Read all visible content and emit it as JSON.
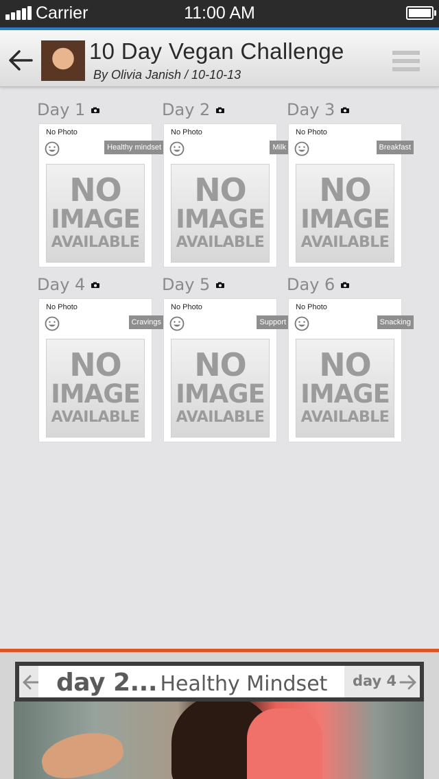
{
  "status_bar": {
    "carrier": "Carrier",
    "time": "11:00 AM"
  },
  "header": {
    "title": "10 Day Vegan Challenge",
    "subtitle": "By Olivia Janish / 10-10-13"
  },
  "days": [
    {
      "label": "Day 1",
      "photo_status": "No Photo",
      "tag": "Healthy mindset",
      "placeholder": [
        "NO",
        "IMAGE",
        "AVAILABLE"
      ]
    },
    {
      "label": "Day 2",
      "photo_status": "No Photo",
      "tag": "Milk",
      "placeholder": [
        "NO",
        "IMAGE",
        "AVAILABLE"
      ]
    },
    {
      "label": "Day 3",
      "photo_status": "No Photo",
      "tag": "Breakfast",
      "placeholder": [
        "NO",
        "IMAGE",
        "AVAILABLE"
      ]
    },
    {
      "label": "Day 4",
      "photo_status": "No Photo",
      "tag": "Cravings",
      "placeholder": [
        "NO",
        "IMAGE",
        "AVAILABLE"
      ]
    },
    {
      "label": "Day 5",
      "photo_status": "No Photo",
      "tag": "Support",
      "placeholder": [
        "NO",
        "IMAGE",
        "AVAILABLE"
      ]
    },
    {
      "label": "Day 6",
      "photo_status": "No Photo",
      "tag": "Snacking",
      "placeholder": [
        "NO",
        "IMAGE",
        "AVAILABLE"
      ]
    }
  ],
  "video_nav": {
    "current_day": "day 2...",
    "current_topic": "Healthy Mindset",
    "next_label": "day 4"
  },
  "colors": {
    "status_bar": "#2b2b2b",
    "accent_blue": "#2b80c5",
    "accent_orange": "#dd5526",
    "background": "#e4e4e6",
    "tag": "#8e8e8e"
  },
  "icons": {
    "back": "arrow-left-icon",
    "menu": "hamburger-icon",
    "camera": "camera-icon",
    "smiley": "smiley-icon",
    "prev": "arrow-left-icon",
    "next": "arrow-right-icon"
  }
}
